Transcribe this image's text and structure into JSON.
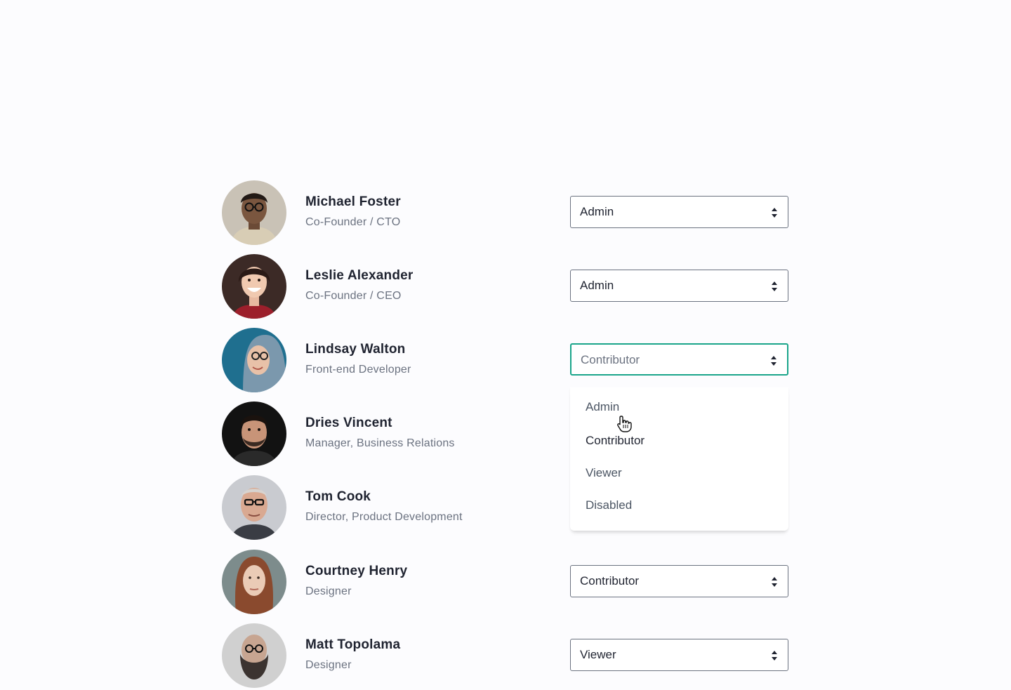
{
  "members": [
    {
      "name": "Michael Foster",
      "role": "Co-Founder / CTO",
      "permission": "Admin"
    },
    {
      "name": "Leslie Alexander",
      "role": "Co-Founder / CEO",
      "permission": "Admin"
    },
    {
      "name": "Lindsay Walton",
      "role": "Front-end Developer",
      "permission": "Contributor"
    },
    {
      "name": "Dries Vincent",
      "role": "Manager, Business Relations"
    },
    {
      "name": "Tom Cook",
      "role": "Director, Product Development"
    },
    {
      "name": "Courtney Henry",
      "role": "Designer",
      "permission": "Contributor"
    },
    {
      "name": "Matt Topolama",
      "role": "Designer",
      "permission": "Viewer"
    }
  ],
  "dropdown": {
    "options": [
      "Admin",
      "Contributor",
      "Viewer",
      "Disabled"
    ],
    "hovered": "Contributor"
  },
  "colors": {
    "focus_border": "#1aa58a",
    "select_border": "#6b7280",
    "name_text": "#1f2330",
    "role_text": "#6b7280"
  },
  "icons": {
    "select_arrows": "chevron-up-down-icon",
    "cursor": "hand-pointer-icon"
  }
}
